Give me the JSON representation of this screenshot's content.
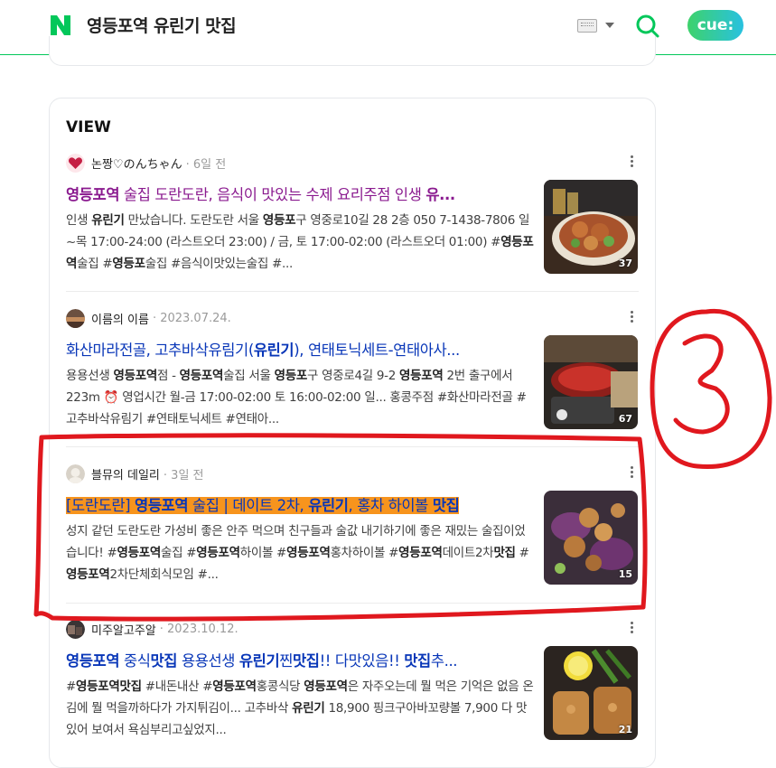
{
  "header": {
    "query": "영등포역 유린기 맛집",
    "cue_label": "cue:"
  },
  "view": {
    "title": "VIEW",
    "items": [
      {
        "author": "논짱♡のんちゃん",
        "date": "6일 전",
        "title_parts": [
          "영등포역",
          " 술집 도란도란, 음식이 맛있는 수제 요리주점 인생 ",
          "유..."
        ],
        "desc_html": "인생 <b>유린기</b> 만났습니다. 도란도란 서울 <b>영등포</b>구 영중로10길 28 2층 050 7-1438-7806 일~목 17:00-24:00 (라스트오더 23:00) / 금, 토 17:00-02:00 (라스트오더 01:00) #<b>영등포역</b>술집 #<b>영등포</b>술집 #음식이맛있는술집 #...",
        "thumb_count": "37"
      },
      {
        "author": "이름의 이름",
        "date": "2023.07.24.",
        "title_parts": [
          "화산마라전골, 고추바삭유림기(",
          "유린기",
          "), 연태토닉세트-연태아사..."
        ],
        "desc_html": "용용선생 <b>영등포역</b>점 - <b>영등포역</b>술집 서울 <b>영등포</b>구 영중로4길 9-2 <b>영등포역</b> 2번 출구에서 223m ⏰ 영업시간 월-금 17:00-02:00 토 16:00-02:00 일... 홍콩주점 #화산마라전골 #고추바삭유림기 #연태토닉세트 #연태아...",
        "thumb_count": "67"
      },
      {
        "author": "블뮤의 데일리",
        "date": "3일 전",
        "title_parts": [
          "[도란도란] ",
          "영등포역",
          " 술집 | 데이트 2차, ",
          "유린기",
          ", 홍차 하이볼 ",
          "맛집"
        ],
        "desc_html": "성지 같던 도란도란 가성비 좋은 안주 먹으며 친구들과 술값 내기하기에 좋은 재밌는 술집이었습니다! #<b>영등포역</b>술집 #<b>영등포역</b>하이볼 #<b>영등포역</b>홍차하이볼 #<b>영등포역</b>데이트2차<b>맛집</b> #<b>영등포역</b>2차단체회식모임 #...",
        "thumb_count": "15"
      },
      {
        "author": "미주알고주알",
        "date": "2023.10.12.",
        "title_parts": [
          "영등포역",
          " 중식",
          "맛집",
          " 용용선생 ",
          "유린기",
          "찐",
          "맛집",
          "!! 다맛있음!! ",
          "맛집",
          "추..."
        ],
        "desc_html": "#<b>영등포역맛집</b> #내돈내산 #<b>영등포역</b>홍콩식당 <b>영등포역</b>은 자주오는데 뭘 먹은 기억은 없음 온김에 뭘 먹을까하다가 가지튀김이... 고추바삭 <b>유린기</b> 18,900 핑크구아바꼬량볼 7,900 다 맛있어 보여서 욕심부리고싶었지...",
        "thumb_count": "21"
      }
    ]
  },
  "annotation": {
    "label": "3",
    "color": "#e0181e"
  }
}
